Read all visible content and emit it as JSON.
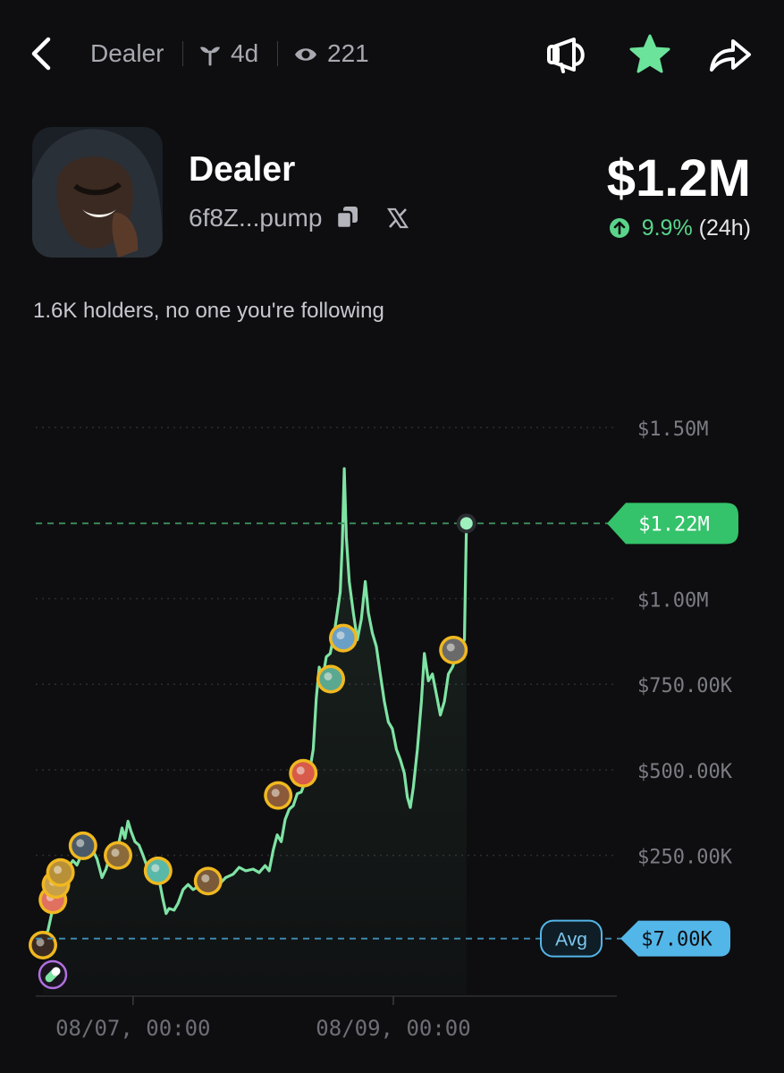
{
  "header": {
    "title": "Dealer",
    "age": "4d",
    "views": "221"
  },
  "token": {
    "name": "Dealer",
    "address": "6f8Z...pump",
    "market_cap": "$1.2M",
    "change_pct": "9.9%",
    "change_period": "(24h)",
    "holders_text": "1.6K holders, no one you're following"
  },
  "colors": {
    "background": "#0e0e10",
    "line": "#7fe3a4",
    "current_tag": "#34c26a",
    "avg_tag": "#53b6e8",
    "marker_ring": "#f0b820",
    "up": "#5ad48a"
  },
  "chart_data": {
    "type": "line",
    "y_unit": "USD market cap",
    "ylim": [
      -20000,
      1550000
    ],
    "y_ticks": [
      {
        "value": 1500000,
        "label": "$1.50M"
      },
      {
        "value": 1000000,
        "label": "$1.00M"
      },
      {
        "value": 750000,
        "label": "$750.00K"
      },
      {
        "value": 500000,
        "label": "$500.00K"
      },
      {
        "value": 250000,
        "label": "$250.00K"
      }
    ],
    "x_ticks": [
      {
        "t": 0.18,
        "label": "08/07, 00:00"
      },
      {
        "t": 0.7,
        "label": "08/09, 00:00"
      }
    ],
    "current": {
      "value": 1220000,
      "label": "$1.22M"
    },
    "avg": {
      "value": 7000,
      "label": "$7.00K",
      "tag": "Avg"
    },
    "grid": "dotted horizontal",
    "series": [
      {
        "points": [
          [
            0.0,
            7000
          ],
          [
            0.01,
            30000
          ],
          [
            0.022,
            110000
          ],
          [
            0.03,
            140000
          ],
          [
            0.04,
            180000
          ],
          [
            0.05,
            215000
          ],
          [
            0.06,
            235000
          ],
          [
            0.068,
            222000
          ],
          [
            0.078,
            255000
          ],
          [
            0.088,
            258000
          ],
          [
            0.098,
            270000
          ],
          [
            0.108,
            240000
          ],
          [
            0.118,
            185000
          ],
          [
            0.126,
            210000
          ],
          [
            0.134,
            250000
          ],
          [
            0.142,
            245000
          ],
          [
            0.15,
            275000
          ],
          [
            0.158,
            330000
          ],
          [
            0.164,
            300000
          ],
          [
            0.17,
            350000
          ],
          [
            0.176,
            320000
          ],
          [
            0.184,
            290000
          ],
          [
            0.192,
            280000
          ],
          [
            0.2,
            250000
          ],
          [
            0.21,
            210000
          ],
          [
            0.222,
            200000
          ],
          [
            0.232,
            180000
          ],
          [
            0.24,
            120000
          ],
          [
            0.246,
            80000
          ],
          [
            0.252,
            95000
          ],
          [
            0.262,
            90000
          ],
          [
            0.27,
            110000
          ],
          [
            0.28,
            150000
          ],
          [
            0.29,
            165000
          ],
          [
            0.3,
            150000
          ],
          [
            0.312,
            160000
          ],
          [
            0.325,
            150000
          ],
          [
            0.34,
            155000
          ],
          [
            0.352,
            165000
          ],
          [
            0.365,
            185000
          ],
          [
            0.38,
            195000
          ],
          [
            0.392,
            215000
          ],
          [
            0.405,
            205000
          ],
          [
            0.42,
            210000
          ],
          [
            0.432,
            200000
          ],
          [
            0.444,
            220000
          ],
          [
            0.452,
            205000
          ],
          [
            0.46,
            265000
          ],
          [
            0.468,
            310000
          ],
          [
            0.476,
            290000
          ],
          [
            0.484,
            355000
          ],
          [
            0.492,
            385000
          ],
          [
            0.5,
            395000
          ],
          [
            0.508,
            430000
          ],
          [
            0.516,
            435000
          ],
          [
            0.524,
            465000
          ],
          [
            0.532,
            490000
          ],
          [
            0.54,
            560000
          ],
          [
            0.546,
            710000
          ],
          [
            0.552,
            800000
          ],
          [
            0.558,
            760000
          ],
          [
            0.566,
            830000
          ],
          [
            0.574,
            840000
          ],
          [
            0.582,
            900000
          ],
          [
            0.588,
            960000
          ],
          [
            0.594,
            1020000
          ],
          [
            0.598,
            1160000
          ],
          [
            0.602,
            1380000
          ],
          [
            0.606,
            1180000
          ],
          [
            0.612,
            1050000
          ],
          [
            0.62,
            960000
          ],
          [
            0.628,
            880000
          ],
          [
            0.636,
            940000
          ],
          [
            0.644,
            1050000
          ],
          [
            0.65,
            960000
          ],
          [
            0.658,
            900000
          ],
          [
            0.666,
            860000
          ],
          [
            0.674,
            780000
          ],
          [
            0.682,
            700000
          ],
          [
            0.69,
            640000
          ],
          [
            0.698,
            620000
          ],
          [
            0.706,
            560000
          ],
          [
            0.714,
            530000
          ],
          [
            0.722,
            490000
          ],
          [
            0.728,
            420000
          ],
          [
            0.734,
            390000
          ],
          [
            0.74,
            450000
          ],
          [
            0.748,
            560000
          ],
          [
            0.756,
            700000
          ],
          [
            0.762,
            840000
          ],
          [
            0.77,
            760000
          ],
          [
            0.778,
            780000
          ],
          [
            0.786,
            720000
          ],
          [
            0.794,
            660000
          ],
          [
            0.802,
            700000
          ],
          [
            0.81,
            780000
          ],
          [
            0.818,
            800000
          ],
          [
            0.826,
            830000
          ],
          [
            0.832,
            860000
          ],
          [
            0.838,
            870000
          ],
          [
            0.842,
            880000
          ],
          [
            0.846,
            1220000
          ]
        ]
      }
    ],
    "trade_markers": [
      {
        "t": 0.0,
        "value": -12000
      },
      {
        "t": 0.02,
        "value": 120000
      },
      {
        "t": 0.026,
        "value": 165000
      },
      {
        "t": 0.035,
        "value": 200000
      },
      {
        "t": 0.08,
        "value": 278000
      },
      {
        "t": 0.15,
        "value": 250000
      },
      {
        "t": 0.23,
        "value": 205000
      },
      {
        "t": 0.33,
        "value": 175000
      },
      {
        "t": 0.47,
        "value": 425000
      },
      {
        "t": 0.52,
        "value": 490000
      },
      {
        "t": 0.575,
        "value": 765000
      },
      {
        "t": 0.6,
        "value": 885000
      },
      {
        "t": 0.82,
        "value": 850000
      }
    ]
  }
}
